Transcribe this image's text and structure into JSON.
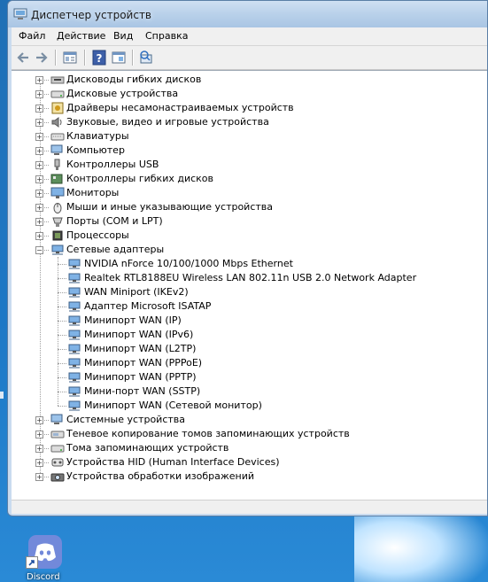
{
  "window": {
    "title": "Диспетчер устройств"
  },
  "menu": [
    "Файл",
    "Действие",
    "Вид",
    "Справка"
  ],
  "toolbar": {
    "icons": [
      "back-icon",
      "forward-icon",
      "properties-icon",
      "help-icon",
      "show-hidden-icon",
      "scan-hardware-icon"
    ]
  },
  "tree": [
    {
      "label": "Дисководы гибких дисков",
      "icon": "floppy-drive-icon",
      "expanded": false
    },
    {
      "label": "Дисковые устройства",
      "icon": "disk-drive-icon",
      "expanded": false
    },
    {
      "label": "Драйверы несамонастраиваемых устройств",
      "icon": "non-pnp-driver-icon",
      "expanded": false
    },
    {
      "label": "Звуковые, видео и игровые устройства",
      "icon": "speaker-icon",
      "expanded": false
    },
    {
      "label": "Клавиатуры",
      "icon": "keyboard-icon",
      "expanded": false
    },
    {
      "label": "Компьютер",
      "icon": "computer-icon",
      "expanded": false
    },
    {
      "label": "Контроллеры USB",
      "icon": "usb-icon",
      "expanded": false
    },
    {
      "label": "Контроллеры гибких дисков",
      "icon": "floppy-controller-icon",
      "expanded": false
    },
    {
      "label": "Мониторы",
      "icon": "monitor-icon",
      "expanded": false
    },
    {
      "label": "Мыши и иные указывающие устройства",
      "icon": "mouse-icon",
      "expanded": false
    },
    {
      "label": "Порты (COM и LPT)",
      "icon": "port-icon",
      "expanded": false
    },
    {
      "label": "Процессоры",
      "icon": "processor-icon",
      "expanded": false
    },
    {
      "label": "Сетевые адаптеры",
      "icon": "network-adapter-icon",
      "expanded": true,
      "children": [
        "NVIDIA nForce 10/100/1000 Mbps Ethernet",
        "Realtek RTL8188EU Wireless LAN 802.11n USB 2.0 Network Adapter",
        "WAN Miniport (IKEv2)",
        "Адаптер Microsoft ISATAP",
        "Минипорт WAN (IP)",
        "Минипорт WAN (IPv6)",
        "Минипорт WAN (L2TP)",
        "Минипорт WAN (PPPoE)",
        "Минипорт WAN (PPTP)",
        "Мини-порт WAN (SSTP)",
        "Минипорт WAN (Сетевой монитор)"
      ]
    },
    {
      "label": "Системные устройства",
      "icon": "system-device-icon",
      "expanded": false
    },
    {
      "label": "Теневое копирование томов запоминающих устройств",
      "icon": "volume-shadow-copy-icon",
      "expanded": false
    },
    {
      "label": "Тома запоминающих устройств",
      "icon": "storage-volume-icon",
      "expanded": false
    },
    {
      "label": "Устройства HID (Human Interface Devices)",
      "icon": "hid-icon",
      "expanded": false
    },
    {
      "label": "Устройства обработки изображений",
      "icon": "imaging-device-icon",
      "expanded": false
    }
  ],
  "desktop": {
    "shortcut_label": "Discord"
  }
}
